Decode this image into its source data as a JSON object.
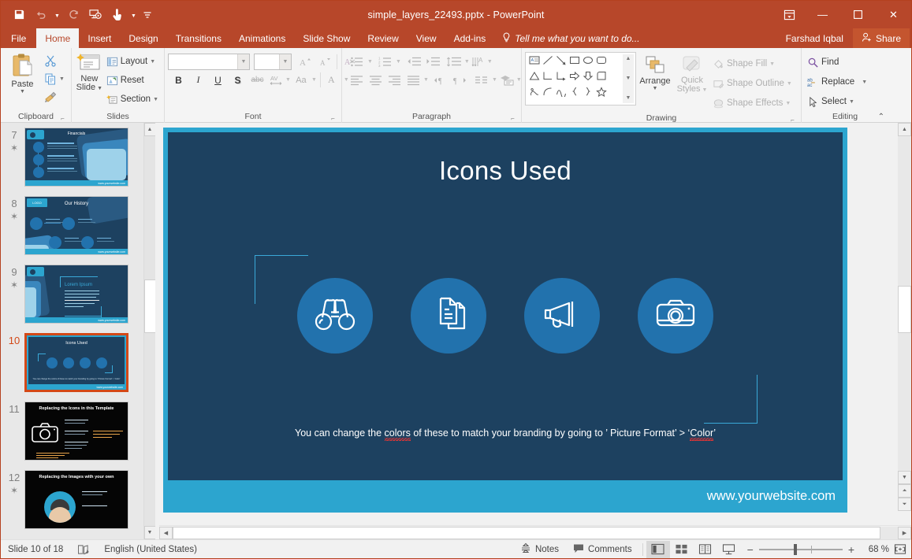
{
  "window": {
    "title": "simple_layers_22493.pptx - PowerPoint",
    "accent": "#b7472a",
    "qat": [
      {
        "name": "save-icon",
        "glyph": "save"
      },
      {
        "name": "undo-icon",
        "glyph": "undo"
      },
      {
        "name": "redo-icon",
        "glyph": "redo"
      },
      {
        "name": "start-presentation-icon",
        "glyph": "present"
      },
      {
        "name": "touch-mode-icon",
        "glyph": "touch"
      },
      {
        "name": "customize-quick-access-toolbar-icon",
        "glyph": "caret"
      }
    ],
    "controls": {
      "ribbon_display_options": "Ribbon Display Options",
      "minimize": "—",
      "restore": "☐",
      "close": "✕"
    }
  },
  "tabs": [
    {
      "label": "File",
      "active": false,
      "file": true
    },
    {
      "label": "Home",
      "active": true
    },
    {
      "label": "Insert",
      "active": false
    },
    {
      "label": "Design",
      "active": false
    },
    {
      "label": "Transitions",
      "active": false
    },
    {
      "label": "Animations",
      "active": false
    },
    {
      "label": "Slide Show",
      "active": false
    },
    {
      "label": "Review",
      "active": false
    },
    {
      "label": "View",
      "active": false
    },
    {
      "label": "Add-ins",
      "active": false
    }
  ],
  "tellme": {
    "placeholder": "Tell me what you want to do..."
  },
  "account": {
    "user": "Farshad Iqbal",
    "share_label": "Share"
  },
  "ribbon": {
    "clipboard": {
      "label": "Clipboard",
      "paste": "Paste",
      "cut": "Cut",
      "copy": "Copy",
      "format_painter": "Format Painter"
    },
    "slides": {
      "label": "Slides",
      "new_slide": "New\nSlide",
      "new_slide_line1": "New",
      "new_slide_line2": "Slide",
      "layout": "Layout",
      "reset": "Reset",
      "section": "Section"
    },
    "font": {
      "label": "Font",
      "font_name": "",
      "font_name_placeholder": "",
      "font_size": "",
      "increase_size": "A",
      "decrease_size": "A",
      "clear_formatting": "Clear All Formatting",
      "bold": "B",
      "italic": "I",
      "underline": "U",
      "shadow": "S",
      "strikethrough": "abc",
      "character_spacing": "AV",
      "change_case": "Aa",
      "font_color": "A"
    },
    "paragraph": {
      "label": "Paragraph",
      "bullets": "Bullets",
      "numbering": "Numbering",
      "decrease_indent": "Decrease List Level",
      "increase_indent": "Increase List Level",
      "line_spacing": "Line Spacing",
      "text_direction": "Text Direction",
      "align_text": "Align Text",
      "convert_smartart": "Convert to SmartArt",
      "align_left": "Align Left",
      "center": "Center",
      "align_right": "Align Right",
      "justify": "Justify",
      "columns": "Columns",
      "ltr": "Left-to-Right",
      "rtl": "Right-to-Left"
    },
    "drawing": {
      "label": "Drawing",
      "arrange": "Arrange",
      "quick_styles_line1": "Quick",
      "quick_styles_line2": "Styles",
      "shape_fill": "Shape Fill",
      "shape_outline": "Shape Outline",
      "shape_effects": "Shape Effects"
    },
    "editing": {
      "label": "Editing",
      "find": "Find",
      "replace": "Replace",
      "select": "Select"
    },
    "collapse_ribbon": "Collapse the Ribbon"
  },
  "thumbnails": [
    {
      "number": "7",
      "title": "Financials",
      "starred": true,
      "selected": false,
      "style": "financials"
    },
    {
      "number": "8",
      "title": "Our History",
      "starred": true,
      "selected": false,
      "style": "history"
    },
    {
      "number": "9",
      "title": "Lorem Ipsum",
      "starred": true,
      "selected": false,
      "style": "quote"
    },
    {
      "number": "10",
      "title": "Icons Used",
      "starred": false,
      "selected": true,
      "style": "icons"
    },
    {
      "number": "11",
      "title": "Replacing the Icons in this Template",
      "starred": false,
      "selected": false,
      "style": "dark-camera"
    },
    {
      "number": "12",
      "title": "Replacing the Images with your own",
      "starred": true,
      "selected": false,
      "style": "dark-image"
    }
  ],
  "slide": {
    "title": "Icons Used",
    "body_prefix": "You can change the ",
    "body_word1": "colors",
    "body_middle": " of these to match your branding by going to ’ Picture Format’ > ‘",
    "body_word2": "Color",
    "body_suffix": "’",
    "body_full": "You can change the colors of these to match your branding by going to ’ Picture Format’ > ‘Color’",
    "website": "www.yourwebsite.com",
    "icons": [
      {
        "name": "binoculars-icon",
        "label": "Binoculars"
      },
      {
        "name": "documents-icon",
        "label": "Documents"
      },
      {
        "name": "megaphone-icon",
        "label": "Megaphone"
      },
      {
        "name": "camera-icon",
        "label": "Camera"
      }
    ],
    "colors": {
      "background": "#1d4160",
      "border": "#2ca5cf",
      "circle": "#2272ad",
      "bracket": "#3aa9d8",
      "text": "#ffffff"
    }
  },
  "statusbar": {
    "slide_position": "Slide 10 of 18",
    "accessibility": "accessibility-checker",
    "language": "English (United States)",
    "notes": "Notes",
    "comments": "Comments",
    "views": [
      {
        "name": "normal-view-button",
        "active": true
      },
      {
        "name": "slide-sorter-button",
        "active": false
      },
      {
        "name": "reading-view-button",
        "active": false
      },
      {
        "name": "slide-show-button",
        "active": false
      }
    ],
    "zoom_out": "−",
    "zoom_in": "+",
    "zoom_level": "68 %",
    "fit_to_window": "Fit slide to current window"
  }
}
